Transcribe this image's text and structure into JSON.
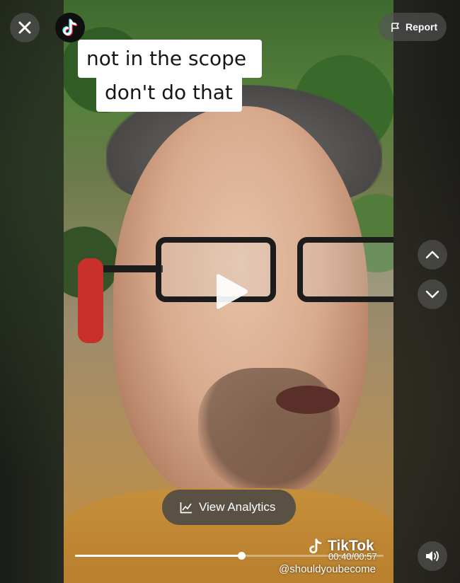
{
  "caption": {
    "line1": "not in the scope",
    "line2": "don't do that"
  },
  "header": {
    "close_icon": "close-icon",
    "logo_icon": "tiktok-logo-icon",
    "report_label": "Report",
    "report_icon": "flag-icon"
  },
  "navigation": {
    "prev_icon": "chevron-up-icon",
    "next_icon": "chevron-down-icon"
  },
  "player": {
    "state_icon": "play-icon",
    "progress_fraction": 0.54,
    "time": "00:40/00:57",
    "volume_icon": "speaker-icon"
  },
  "analytics": {
    "label": "View Analytics",
    "icon": "line-chart-icon"
  },
  "watermark": {
    "brand": "TikTok",
    "handle": "@shouldyoubecome"
  },
  "colors": {
    "overlay_button": "#545454",
    "tiktok_cyan": "#25F4EE",
    "tiktok_red": "#FE2C55"
  }
}
